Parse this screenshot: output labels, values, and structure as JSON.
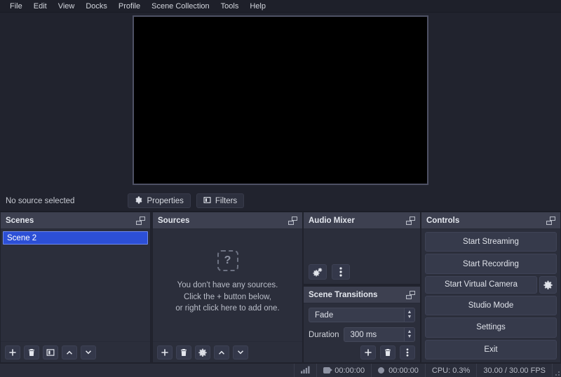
{
  "menubar": {
    "items": [
      {
        "label": "File"
      },
      {
        "label": "Edit"
      },
      {
        "label": "View"
      },
      {
        "label": "Docks"
      },
      {
        "label": "Profile"
      },
      {
        "label": "Scene Collection"
      },
      {
        "label": "Tools"
      },
      {
        "label": "Help"
      }
    ]
  },
  "preview": {
    "canvas_color": "#000000"
  },
  "source_controls": {
    "status_text": "No source selected",
    "properties_label": "Properties",
    "filters_label": "Filters"
  },
  "scenes": {
    "title": "Scenes",
    "items": [
      {
        "label": "Scene 2",
        "selected": true
      }
    ],
    "toolbar": [
      {
        "name": "add-scene-button",
        "icon": "plus-icon"
      },
      {
        "name": "remove-scene-button",
        "icon": "trash-icon"
      },
      {
        "name": "scene-filters-button",
        "icon": "filters-icon"
      },
      {
        "name": "move-scene-up-button",
        "icon": "chevron-up-icon"
      },
      {
        "name": "move-scene-down-button",
        "icon": "chevron-down-icon"
      }
    ]
  },
  "sources": {
    "title": "Sources",
    "empty_icon": "question-mark-icon",
    "empty_glyph": "?",
    "empty_lines": [
      "You don't have any sources.",
      "Click the + button below,",
      "or right click here to add one."
    ],
    "toolbar": [
      {
        "name": "add-source-button",
        "icon": "plus-icon"
      },
      {
        "name": "remove-source-button",
        "icon": "trash-icon"
      },
      {
        "name": "source-properties-button",
        "icon": "gear-icon"
      },
      {
        "name": "move-source-up-button",
        "icon": "chevron-up-icon"
      },
      {
        "name": "move-source-down-button",
        "icon": "chevron-down-icon"
      }
    ]
  },
  "audio_mixer": {
    "title": "Audio Mixer",
    "advanced_properties_icon": "gears-icon",
    "menu_icon": "vertical-dots-icon"
  },
  "scene_transitions": {
    "title": "Scene Transitions",
    "transition_value": "Fade",
    "duration_label": "Duration",
    "duration_value": "300 ms",
    "toolbar": [
      {
        "name": "add-transition-button",
        "icon": "plus-icon"
      },
      {
        "name": "remove-transition-button",
        "icon": "trash-icon"
      },
      {
        "name": "transition-menu-button",
        "icon": "vertical-dots-icon"
      }
    ]
  },
  "controls": {
    "title": "Controls",
    "start_streaming": "Start Streaming",
    "start_recording": "Start Recording",
    "start_virtual_camera": "Start Virtual Camera",
    "virtual_camera_config_icon": "gear-icon",
    "studio_mode": "Studio Mode",
    "settings": "Settings",
    "exit": "Exit"
  },
  "statusbar": {
    "signal_icon": "signal-bars-icon",
    "stream_icon": "stream-icon",
    "stream_time": "00:00:00",
    "record_icon": "record-dot-icon",
    "record_time": "00:00:00",
    "cpu": "CPU: 0.3%",
    "fps": "30.00 / 30.00 FPS"
  },
  "colors": {
    "window_bg": "#21232e",
    "dock_bg": "#2b2e3b",
    "dock_header_bg": "#3d4050",
    "accent_selection": "#2c4fd6",
    "text": "#d6d9e0"
  }
}
